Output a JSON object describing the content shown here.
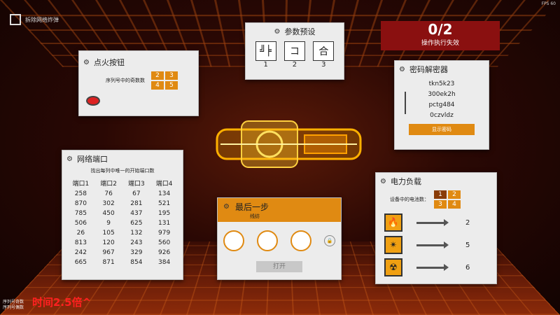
{
  "top_left": {
    "title": "拆除网络炸弹"
  },
  "fps": "FPS 60",
  "status": {
    "score": "0/2",
    "label": "操作执行失效"
  },
  "ignition": {
    "title": "点火按钮",
    "hint": "序列号中的奇数数",
    "buttons": [
      "2",
      "3",
      "4",
      "5"
    ]
  },
  "params": {
    "title": "参数预设",
    "options": [
      {
        "glyph": "╝╞",
        "label": "1"
      },
      {
        "glyph": "コ",
        "label": "2"
      },
      {
        "glyph": "合",
        "label": "3"
      }
    ]
  },
  "decoder": {
    "title": "密码解密器",
    "codes": [
      "tkn5k23",
      "300ek2h",
      "pctg484",
      "0czvldz"
    ],
    "button": "显示密码"
  },
  "ports": {
    "title": "网络端口",
    "hint": "找出每列中唯一的开始端口数",
    "headers": [
      "端口1",
      "端口2",
      "端口3",
      "端口4"
    ],
    "rows": [
      [
        "258",
        "76",
        "67",
        "134"
      ],
      [
        "870",
        "302",
        "281",
        "521"
      ],
      [
        "785",
        "450",
        "437",
        "195"
      ],
      [
        "506",
        "9",
        "625",
        "131"
      ],
      [
        "26",
        "105",
        "132",
        "979"
      ],
      [
        "813",
        "120",
        "243",
        "560"
      ],
      [
        "242",
        "967",
        "329",
        "926"
      ],
      [
        "665",
        "871",
        "854",
        "384"
      ]
    ]
  },
  "final": {
    "title": "最后一步",
    "subtitle": "线纺",
    "button": "打开"
  },
  "power": {
    "title": "电力负载",
    "hint": "设备中的电池数：",
    "buttons": [
      "1",
      "2",
      "3",
      "4"
    ],
    "rows": [
      {
        "icon": "fire-hazard-icon",
        "value": "2"
      },
      {
        "icon": "laser-hazard-icon",
        "value": "5"
      },
      {
        "icon": "radiation-hazard-icon",
        "value": "6"
      }
    ]
  },
  "bottom_left": {
    "line1": "序列号奇数",
    "line2": "序列号偶数"
  },
  "speed": "时间2.5倍^"
}
